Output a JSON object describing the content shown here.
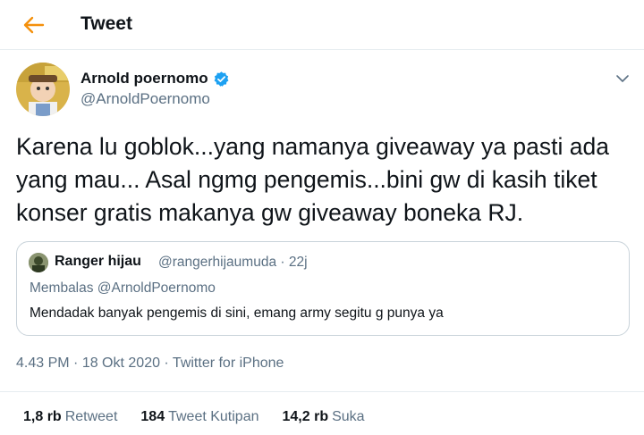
{
  "header": {
    "title": "Tweet",
    "back_icon": "arrow-left-icon",
    "accent": "#f4900c"
  },
  "author": {
    "name": "Arnold poernomo",
    "handle": "@ArnoldPoernomo",
    "verified_icon": "verified-badge-icon",
    "verified_color": "#1da1f2"
  },
  "tweet": {
    "text": "Karena lu goblok...yang namanya giveaway ya pasti ada yang mau... Asal ngmg pengemis...bini gw di kasih tiket konser gratis makanya gw giveaway boneka RJ."
  },
  "quote": {
    "name": "Ranger hijau",
    "handle_time": "@rangerhijaumuda · 22j",
    "reply_to": "Membalas @ArnoldPoernomo",
    "text": "Mendadak banyak pengemis di sini, emang army segitu g punya ya"
  },
  "meta": {
    "time": "4.43 PM",
    "date": "18 Okt 2020",
    "source": "Twitter for iPhone",
    "sep": " · "
  },
  "stats": [
    {
      "count": "1,8 rb",
      "label": "Retweet"
    },
    {
      "count": "184",
      "label": "Tweet Kutipan"
    },
    {
      "count": "14,2 rb",
      "label": "Suka"
    }
  ]
}
